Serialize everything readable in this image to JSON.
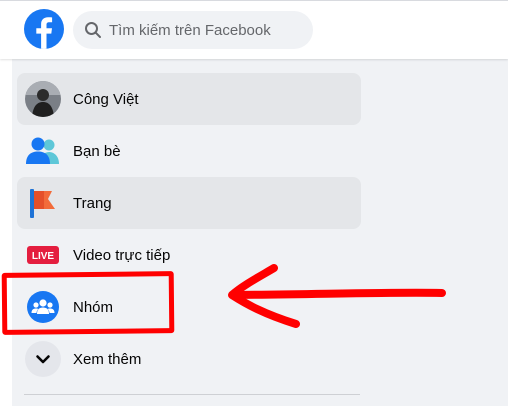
{
  "search": {
    "placeholder": "Tìm kiếm trên Facebook"
  },
  "sidebar": {
    "items": [
      {
        "label": "Công Việt",
        "icon": "profile-avatar"
      },
      {
        "label": "Bạn bè",
        "icon": "friends-icon"
      },
      {
        "label": "Trang",
        "icon": "pages-flag-icon"
      },
      {
        "label": "Video trực tiếp",
        "icon": "live-video-icon",
        "badge": "LIVE"
      },
      {
        "label": "Nhóm",
        "icon": "groups-icon"
      },
      {
        "label": "Xem thêm",
        "icon": "chevron-down-icon"
      }
    ]
  },
  "colors": {
    "brand": "#1877f2",
    "annotation": "#ff0000",
    "live": "#e41e3f"
  }
}
